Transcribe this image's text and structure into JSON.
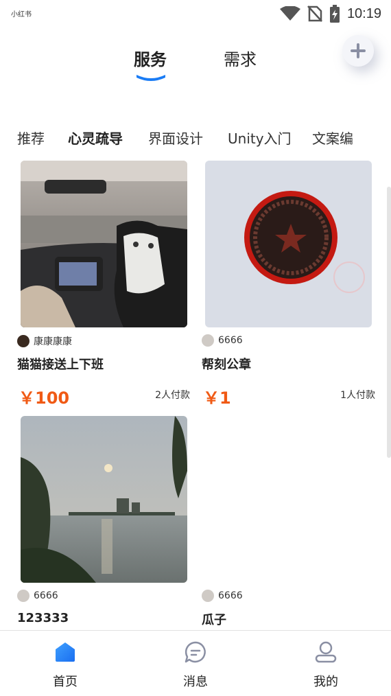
{
  "status_bar": {
    "app_name": "小红书",
    "time": "10:19",
    "icons": [
      "wifi-icon",
      "no-sim-icon",
      "battery-charging-icon"
    ]
  },
  "top_tabs": {
    "tabs": [
      {
        "label": "服务",
        "active": true
      },
      {
        "label": "需求",
        "active": false
      }
    ],
    "add_icon": "plus-icon"
  },
  "categories": [
    {
      "label": "推荐",
      "active": false
    },
    {
      "label": "心灵疏导",
      "active": true
    },
    {
      "label": "界面设计",
      "active": false
    },
    {
      "label": "Unity入门",
      "active": false
    },
    {
      "label": "文案编",
      "active": false
    }
  ],
  "cards": [
    {
      "author": "康康康康",
      "title": "猫猫接送上下班",
      "price": "￥100",
      "payers": "2人付款",
      "image": "cat-in-car-photo"
    },
    {
      "author": "6666",
      "title": "帮刻公章",
      "price": "￥1",
      "payers": "1人付款",
      "image": "red-stamp-photo"
    },
    {
      "author": "6666",
      "title": "123333",
      "image": "lake-sunset-photo"
    },
    {
      "author": "6666",
      "title": "瓜子"
    }
  ],
  "bottom_nav": [
    {
      "label": "首页",
      "icon": "home-icon",
      "active": true
    },
    {
      "label": "消息",
      "icon": "message-icon",
      "active": false
    },
    {
      "label": "我的",
      "icon": "profile-icon",
      "active": false
    }
  ],
  "colors": {
    "accent": "#1a7cf5",
    "price": "#f05a15",
    "text": "#222222"
  }
}
